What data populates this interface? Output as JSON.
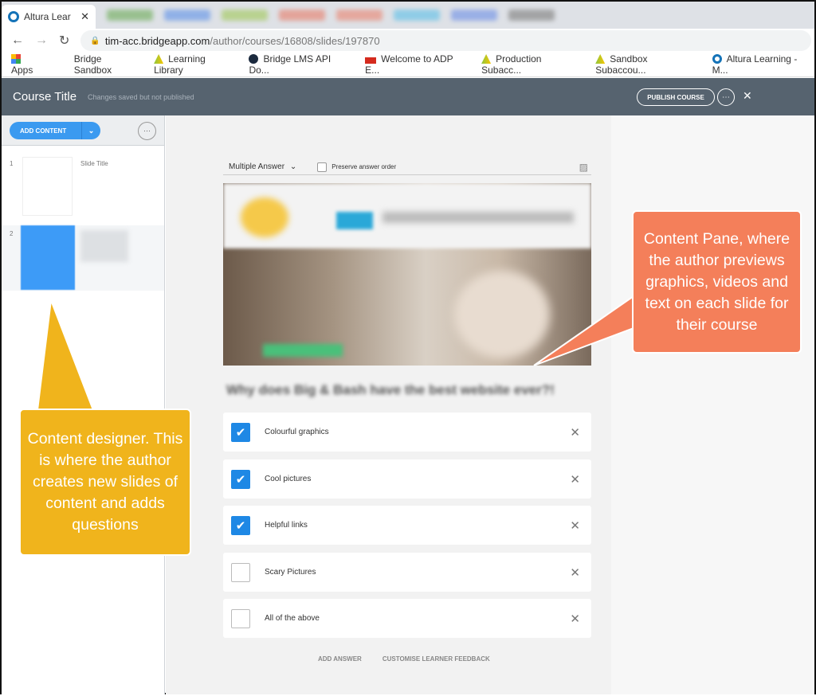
{
  "browser": {
    "active_tab": "Altura Lear",
    "url_host": "tim-acc.bridgeapp.com",
    "url_path": "/author/courses/16808/slides/197870",
    "bookmarks": [
      "Apps",
      "Bridge Sandbox",
      "Learning Library",
      "Bridge LMS API Do...",
      "Welcome to ADP E...",
      "Production Subacc...",
      "Sandbox Subaccou...",
      "Altura Learning - M..."
    ]
  },
  "header": {
    "title": "Course Title",
    "status": "Changes saved but not published",
    "publish": "PUBLISH COURSE",
    "more": "⋯",
    "close": "✕"
  },
  "sidebar": {
    "add_content": "ADD CONTENT",
    "dropdown": "⌄",
    "more": "⋯",
    "slides": [
      {
        "num": "1",
        "title": "Slide Title"
      },
      {
        "num": "2",
        "title": ""
      }
    ]
  },
  "editor": {
    "question_type": "Multiple Answer",
    "preserve_label": "Preserve answer order",
    "question": "Why does Big & Bash have the best website ever?!",
    "answers": [
      {
        "text": "Colourful graphics",
        "checked": true
      },
      {
        "text": "Cool pictures",
        "checked": true
      },
      {
        "text": "Helpful links",
        "checked": true
      },
      {
        "text": "Scary Pictures",
        "checked": false
      },
      {
        "text": "All of the above",
        "checked": false
      }
    ],
    "add_answer": "ADD ANSWER",
    "feedback": "CUSTOMISE LEARNER FEEDBACK"
  },
  "callouts": {
    "designer": "Content designer. This is where the author creates new slides of content and adds questions",
    "pane": "Content Pane, where the author previews graphics, videos and text on each slide for their course"
  },
  "colors": {
    "header": "#56636f",
    "accent": "#1e88e5",
    "yellow": "#f0b41c",
    "orange": "#f47f5a"
  }
}
